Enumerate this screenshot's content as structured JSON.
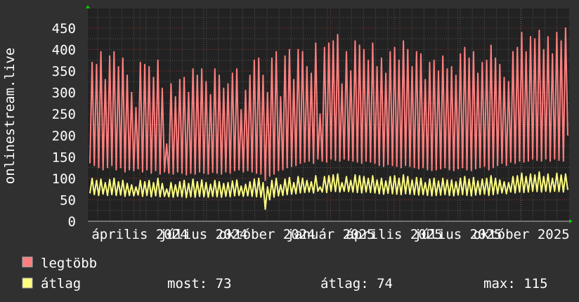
{
  "chart_data": {
    "type": "line",
    "title": "",
    "ylabel": "onlinestream.live",
    "xlabel": "",
    "ylim": [
      0,
      495
    ],
    "yticks": [
      "0",
      "50",
      "100",
      "150",
      "200",
      "250",
      "300",
      "350",
      "400",
      "450"
    ],
    "ytick_values": [
      0,
      50,
      100,
      150,
      200,
      250,
      300,
      350,
      400,
      450
    ],
    "xticks": [
      "április 2024",
      "július 2024",
      "október 2024",
      "január 2025",
      "április 2025",
      "július 2025",
      "október 2025"
    ],
    "grid": true,
    "colors": {
      "background": "#303030",
      "plot": "#222222",
      "grid": "#555555",
      "major_grid": "#7a3a3a",
      "max": "#ff7f7f",
      "avg": "#ffff80",
      "axis_arrow": "#00cc00"
    },
    "series": [
      {
        "name": "legtöbb",
        "values": [
          135,
          370,
          130,
          365,
          125,
          395,
          120,
          330,
          125,
          385,
          130,
          395,
          120,
          360,
          125,
          380,
          115,
          340,
          120,
          300,
          118,
          265,
          122,
          370,
          115,
          365,
          120,
          360,
          112,
          335,
          118,
          375,
          110,
          310,
          115,
          180,
          112,
          320,
          110,
          290,
          115,
          330,
          112,
          335,
          108,
          300,
          112,
          355,
          110,
          340,
          115,
          355,
          112,
          325,
          110,
          295,
          114,
          355,
          112,
          340,
          110,
          310,
          115,
          320,
          112,
          345,
          118,
          355,
          120,
          260,
          115,
          305,
          118,
          340,
          115,
          375,
          112,
          380,
          110,
          340,
          95,
          300,
          105,
          380,
          110,
          395,
          118,
          290,
          120,
          385,
          125,
          400,
          128,
          330,
          130,
          400,
          135,
          395,
          138,
          360,
          140,
          345,
          135,
          415,
          145,
          250,
          140,
          405,
          138,
          415,
          145,
          420,
          142,
          435,
          140,
          320,
          145,
          395,
          142,
          350,
          140,
          420,
          138,
          410,
          135,
          400,
          140,
          375,
          138,
          415,
          135,
          360,
          130,
          380,
          128,
          345,
          132,
          395,
          130,
          405,
          128,
          375,
          125,
          420,
          130,
          400,
          128,
          360,
          125,
          395,
          122,
          390,
          125,
          330,
          120,
          370,
          118,
          375,
          120,
          350,
          122,
          385,
          125,
          355,
          120,
          360,
          118,
          340,
          122,
          390,
          125,
          405,
          120,
          380,
          118,
          395,
          122,
          345,
          125,
          370,
          128,
          375,
          120,
          410,
          125,
          380,
          130,
          365,
          135,
          335,
          130,
          325,
          138,
          395,
          135,
          405,
          140,
          440,
          138,
          395,
          140,
          430,
          145,
          425,
          142,
          445,
          140,
          400,
          145,
          430,
          140,
          390,
          145,
          440,
          142,
          420,
          140,
          450,
          200
        ]
      },
      {
        "name": "átlag",
        "values": [
          65,
          100,
          62,
          95,
          60,
          98,
          63,
          90,
          60,
          97,
          62,
          100,
          60,
          92,
          61,
          95,
          58,
          88,
          60,
          85,
          59,
          80,
          61,
          95,
          58,
          92,
          60,
          95,
          57,
          90,
          59,
          100,
          57,
          88,
          58,
          75,
          57,
          90,
          56,
          85,
          58,
          92,
          57,
          95,
          55,
          88,
          57,
          98,
          56,
          92,
          58,
          96,
          57,
          90,
          56,
          86,
          58,
          95,
          57,
          92,
          56,
          88,
          58,
          90,
          57,
          94,
          59,
          96,
          60,
          82,
          58,
          86,
          59,
          92,
          58,
          98,
          57,
          100,
          56,
          90,
          28,
          80,
          50,
          95,
          56,
          100,
          59,
          85,
          60,
          98,
          62,
          102,
          63,
          90,
          64,
          104,
          66,
          100,
          67,
          95,
          68,
          92,
          66,
          106,
          70,
          80,
          68,
          104,
          67,
          106,
          70,
          108,
          69,
          110,
          68,
          90,
          70,
          104,
          69,
          95,
          68,
          108,
          67,
          106,
          66,
          104,
          68,
          100,
          67,
          106,
          66,
          96,
          64,
          100,
          63,
          94,
          65,
          104,
          64,
          106,
          63,
          100,
          62,
          108,
          64,
          104,
          63,
          96,
          62,
          102,
          61,
          100,
          62,
          90,
          60,
          98,
          59,
          100,
          60,
          94,
          61,
          100,
          62,
          96,
          60,
          96,
          59,
          92,
          61,
          100,
          62,
          104,
          60,
          98,
          59,
          102,
          61,
          94,
          62,
          98,
          63,
          100,
          60,
          106,
          62,
          100,
          64,
          96,
          66,
          92,
          64,
          90,
          68,
          104,
          66,
          106,
          68,
          112,
          67,
          104,
          68,
          110,
          70,
          108,
          69,
          115,
          68,
          104,
          70,
          110,
          68,
          100,
          70,
          112,
          69,
          108,
          68,
          110,
          73
        ]
      }
    ],
    "legend": [
      {
        "label": "legtöbb",
        "color": "#ff7f7f"
      },
      {
        "label": "átlag",
        "color": "#ffff80",
        "stats": {
          "most": "most: 73",
          "atlag": "átlag: 74",
          "max": "max: 115"
        }
      }
    ],
    "legend_placement": "bottom-left"
  }
}
